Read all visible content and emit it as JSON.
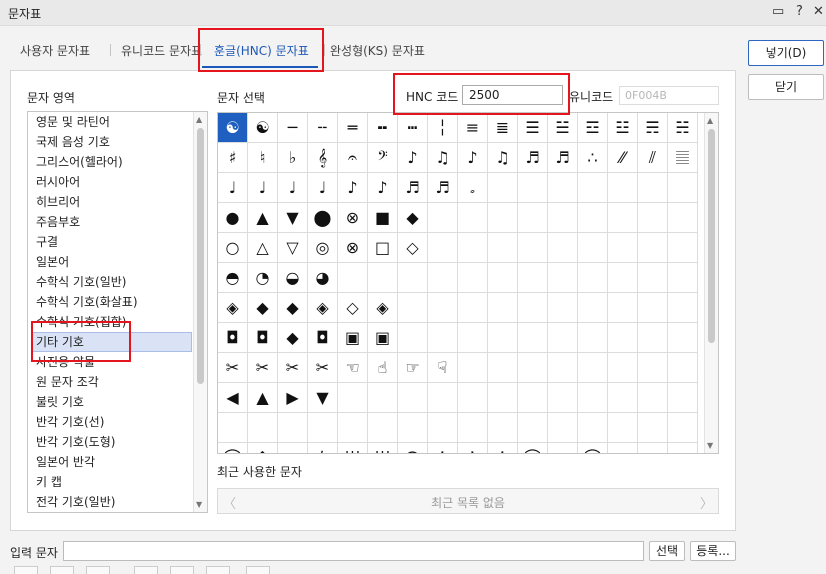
{
  "window": {
    "title": "문자표",
    "help_icon": "?",
    "close_icon": "✕"
  },
  "tabs": [
    {
      "label": "사용자 문자표"
    },
    {
      "label": "유니코드 문자표"
    },
    {
      "label": "훈글(HNC) 문자표"
    },
    {
      "label": "완성형(KS) 문자표"
    }
  ],
  "labels": {
    "area": "문자 영역",
    "select": "문자 선택",
    "hnc": "HNC 코드",
    "unicode": "유니코드",
    "recent": "최근 사용한 문자",
    "input": "입력 문자"
  },
  "hnc_code": {
    "value": "2500"
  },
  "unicode_code": {
    "value": "0F004B"
  },
  "area_list": [
    "영문 및 라틴어",
    "국제 음성 기호",
    "그리스어(헬라어)",
    "러시아어",
    "히브리어",
    "주음부호",
    "구결",
    "일본어",
    "수학식 기호(일반)",
    "수학식 기호(화살표)",
    "수학식 기호(집합)",
    "기타 기호",
    "사진용 약물",
    "원 문자 조각",
    "불릿 기호",
    "반각 기호(선)",
    "반각 기호(도형)",
    "일본어 반각",
    "키 캡",
    "전각 기호(일반)"
  ],
  "selected_area": "기타 기호",
  "chars": [
    [
      "☯",
      "☯",
      "─",
      "╌",
      "═",
      "╍",
      "┅",
      "╎",
      "≡",
      "≣",
      "☰",
      "☱",
      "☲",
      "☳",
      "☴",
      "☵"
    ],
    [
      "♯",
      "♮",
      "♭",
      "𝄞",
      "𝄐",
      "𝄢",
      "♪",
      "♫",
      "♪",
      "♫",
      "♬",
      "♬",
      "∴",
      "⁄⁄",
      "⫽",
      "𝄚"
    ],
    [
      "♩",
      "♩",
      "♩",
      "♩",
      "♪",
      "♪",
      "♬",
      "♬",
      "𝅗"
    ],
    [
      "●",
      "▲",
      "▼",
      "⬤",
      "⊗",
      "■",
      "◆"
    ],
    [
      "○",
      "△",
      "▽",
      "◎",
      "⊗",
      "□",
      "◇"
    ],
    [
      "◓",
      "◔",
      "◒",
      "◕"
    ],
    [
      "◈",
      "◆",
      "◆",
      "◈",
      "◇",
      "◈"
    ],
    [
      "◘",
      "◘",
      "◆",
      "◘",
      "▣",
      "▣"
    ],
    [
      "✂",
      "✂",
      "✂",
      "✂",
      "☜",
      "☝",
      "☞",
      "☟"
    ],
    [
      "◀",
      "▲",
      "▶",
      "▼"
    ],
    [],
    [
      "⌒",
      "⌃",
      "✂",
      "⌇",
      "|||",
      "|||",
      "☊",
      "✝",
      "✝",
      "✝",
      "⌒",
      "⌁",
      "⌒"
    ]
  ],
  "recent": {
    "empty_text": "최근 목록 없음",
    "prev": "〈",
    "next": "〉"
  },
  "buttons": {
    "insert": "넣기(D)",
    "close": "닫기",
    "select": "선택",
    "register": "등록..."
  },
  "colors": {
    "accent": "#1c58b8",
    "selection_fill": "#1f5fbf",
    "annotation": "#e4151c"
  }
}
